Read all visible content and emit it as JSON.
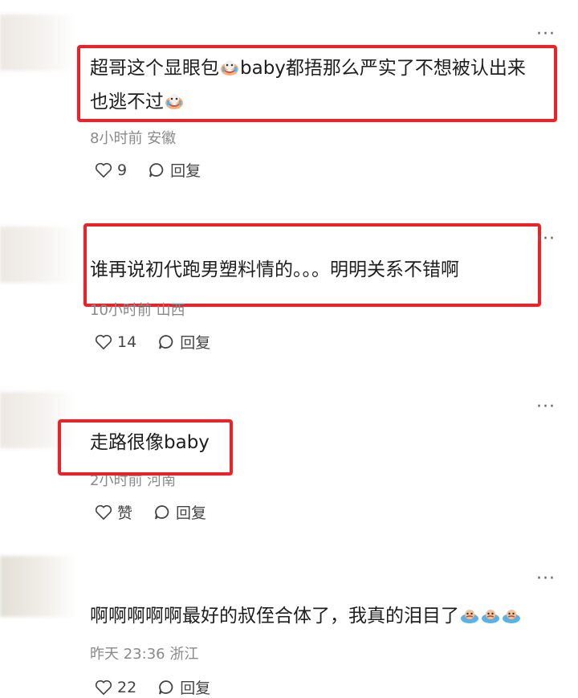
{
  "colors": {
    "highlight": "#e8242a",
    "meta": "#8a8a8a",
    "text": "#1e1e1e"
  },
  "more_label": "···",
  "comments": [
    {
      "line1": "超哥这个显眼包",
      "line1b": "baby都捂那么严实了不想被认出来",
      "line2": "也逃不过",
      "meta": "8小时前 安徽",
      "likes": "9",
      "reply": "回复"
    },
    {
      "text": "谁再说初代跑男塑料情的。。。明明关系不错啊",
      "meta": "10小时前 山西",
      "likes": "14",
      "reply": "回复"
    },
    {
      "text": "走路很像baby",
      "meta": "2小时前 河南",
      "likes": "赞",
      "reply": "回复"
    },
    {
      "text": "啊啊啊啊啊最好的叔侄合体了，我真的泪目了",
      "meta": "昨天 23:36 浙江",
      "likes": "22",
      "reply": "回复"
    }
  ]
}
